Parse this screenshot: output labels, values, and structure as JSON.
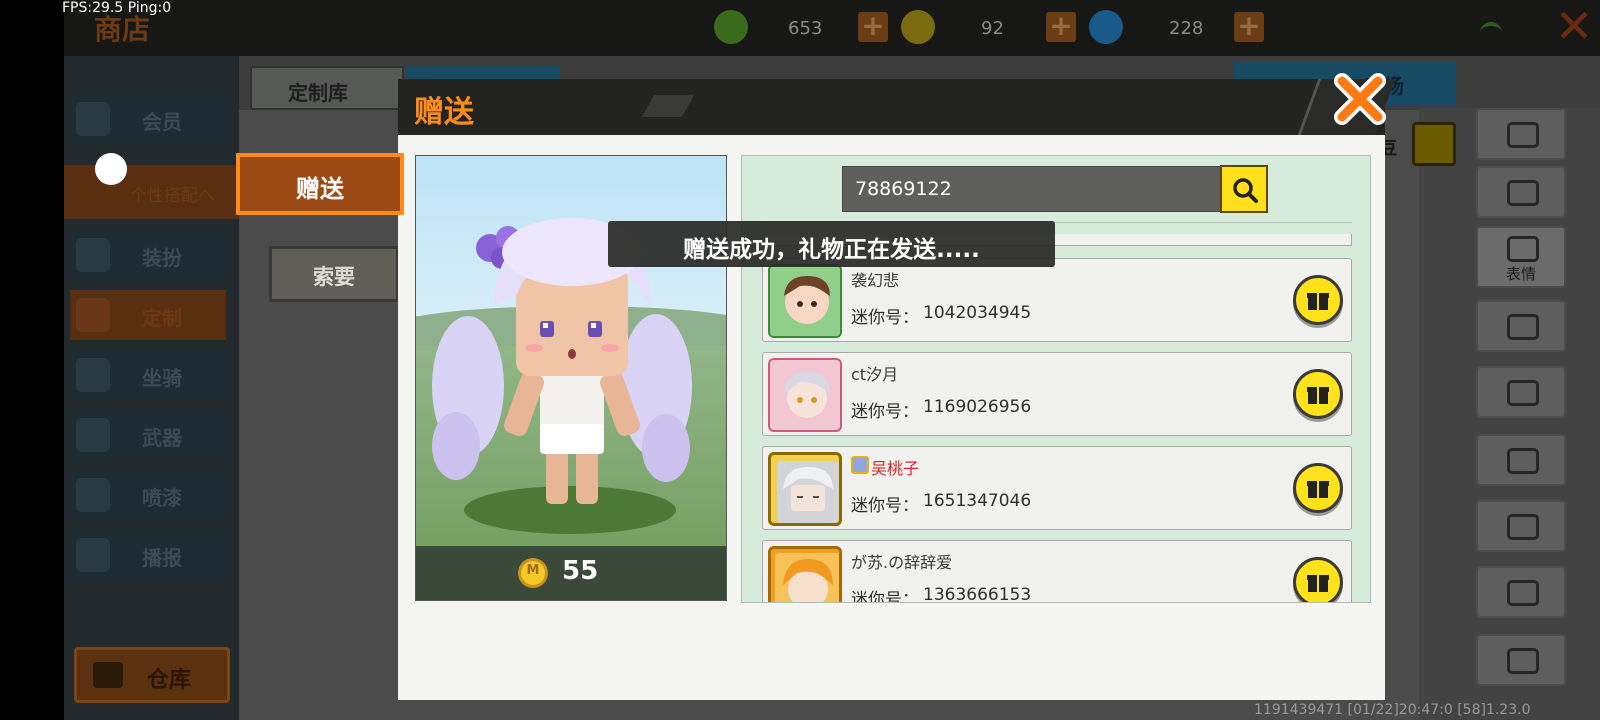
{
  "debug": {
    "fps_text": "FPS:29.5  Ping:0"
  },
  "topbar": {
    "title": "商店",
    "currencies": [
      {
        "icon": "green-bean-icon",
        "value": "653",
        "color": "#3a6a1c"
      },
      {
        "icon": "mini-coin-icon",
        "value": "92",
        "color": "#7a6a10"
      },
      {
        "icon": "blue-star-icon",
        "value": "228",
        "color": "#1a5a8a"
      }
    ],
    "plus_label": "+",
    "close_label": "✕"
  },
  "sidebar": {
    "items": [
      {
        "label": "会员",
        "icon": "vip-icon",
        "active": false
      },
      {
        "label": "个性搭配へ",
        "icon": "outfit-icon",
        "active": true
      },
      {
        "label": "装扮",
        "icon": "costume-icon",
        "active": false
      },
      {
        "label": "定制",
        "icon": "custom-icon",
        "active": true
      },
      {
        "label": "坐骑",
        "icon": "mount-icon",
        "active": false
      },
      {
        "label": "武器",
        "icon": "weapon-icon",
        "active": false
      },
      {
        "label": "喷漆",
        "icon": "spray-icon",
        "active": false
      },
      {
        "label": "播报",
        "icon": "broadcast-icon",
        "active": false
      }
    ],
    "warehouse_label": "仓库"
  },
  "background": {
    "tab_library": "定制库",
    "tab_workshop": "工场",
    "bean_label": "豆",
    "right_tiles": [
      {
        "icon": "hair-icon",
        "label": ""
      },
      {
        "icon": "face-icon",
        "label": ""
      },
      {
        "icon": "expression-icon",
        "label": "表情"
      },
      {
        "icon": "mask-icon",
        "label": ""
      },
      {
        "icon": "shirt-icon",
        "label": ""
      },
      {
        "icon": "gloves-icon",
        "label": ""
      },
      {
        "icon": "pants-icon",
        "label": ""
      },
      {
        "icon": "shoes-icon",
        "label": ""
      },
      {
        "icon": "backpack-icon",
        "label": ""
      }
    ],
    "footer_info": "1191439471    [01/22]20:47:0   [58]1.23.0"
  },
  "dialog": {
    "title": "赠送",
    "tabs": {
      "gift": "赠送",
      "ask": "索要"
    },
    "price": "55",
    "search": {
      "value": "78869122",
      "placeholder": ""
    },
    "id_label": "迷你号：",
    "friends": [
      {
        "name": "袭幻悲",
        "id": "1042034945",
        "vip": false,
        "avatar_color": "#f4b8b0"
      },
      {
        "name": "ct汐月",
        "id": "1169026956",
        "vip": false,
        "avatar_color": "#e7a4b6"
      },
      {
        "name": "吴桃子",
        "id": "1651347046",
        "vip": true,
        "avatar_color": "#f5d04a"
      },
      {
        "name": "が苏.の辞辞爱",
        "id": "1363666153",
        "vip": false,
        "avatar_color": "#f0a020"
      }
    ]
  },
  "toast": {
    "message": "赠送成功，礼物正在发送....."
  }
}
